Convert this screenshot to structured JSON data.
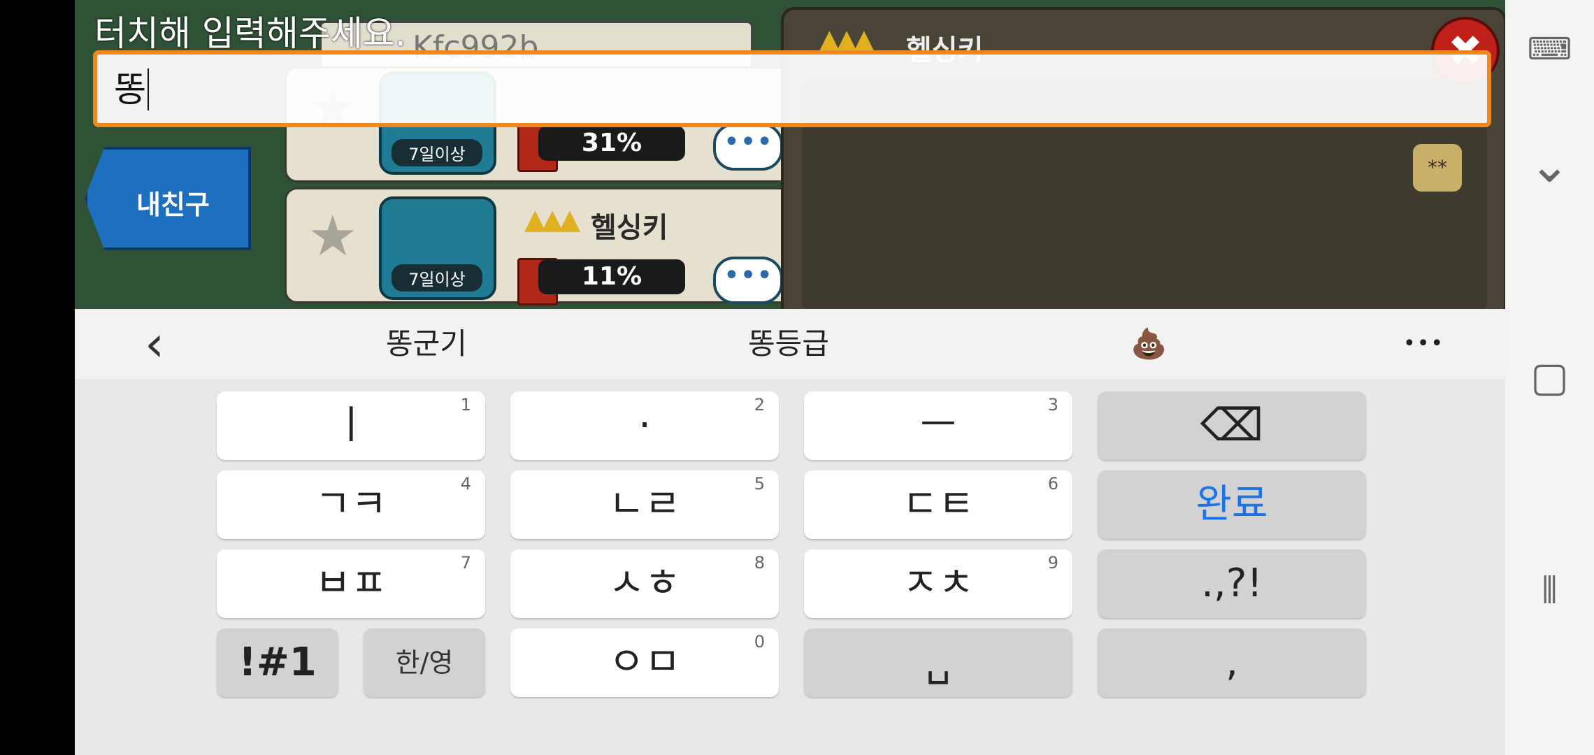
{
  "game": {
    "prompt": "터치해 입력해주세요.",
    "input_value": "똥",
    "friend_id": "Kfc992b",
    "my_friend_tab": "내친구",
    "friends": [
      {
        "avatar_label": "7일이상",
        "percent": "31%",
        "name": ""
      },
      {
        "avatar_label": "7일이상",
        "percent": "11%",
        "name": "헬싱키"
      }
    ],
    "right_panel_name": "헬싱키",
    "close_glyph": "✖",
    "star_badge": "**",
    "chat_glyph": "•••"
  },
  "suggestions": {
    "back_glyph": "‹",
    "items": [
      "똥군기",
      "똥등급",
      "💩"
    ],
    "more_glyph": "•••"
  },
  "keyboard": {
    "rows": [
      [
        {
          "label": "ㅣ",
          "num": "1"
        },
        {
          "label": "·",
          "num": "2"
        },
        {
          "label": "ㅡ",
          "num": "3"
        },
        {
          "label": "⌫",
          "num": ""
        }
      ],
      [
        {
          "label": "ㄱㅋ",
          "num": "4"
        },
        {
          "label": "ㄴㄹ",
          "num": "5"
        },
        {
          "label": "ㄷㅌ",
          "num": "6"
        },
        {
          "label": "완료",
          "num": ""
        }
      ],
      [
        {
          "label": "ㅂㅍ",
          "num": "7"
        },
        {
          "label": "ㅅㅎ",
          "num": "8"
        },
        {
          "label": "ㅈㅊ",
          "num": "9"
        },
        {
          "label": ".,?!",
          "num": ""
        }
      ],
      [
        {
          "label": "!#1",
          "num": ""
        },
        {
          "label": "한/영",
          "num": ""
        },
        {
          "label": "ㅇㅁ",
          "num": "0"
        },
        {
          "label": "␣",
          "num": ""
        },
        {
          "label": ",",
          "num": ""
        }
      ]
    ],
    "done_color": "#1a73e8"
  },
  "nav": {
    "keyboard_glyph": "⌨",
    "hide_glyph": "⌄",
    "home_glyph": "▢",
    "recents_glyph": "⦀"
  }
}
